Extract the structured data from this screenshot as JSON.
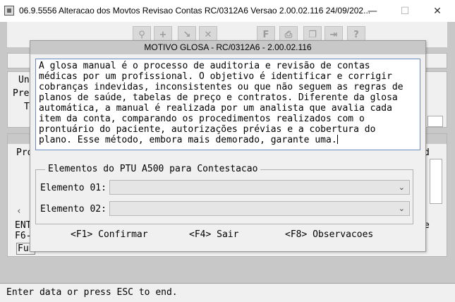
{
  "window": {
    "title": "06.9.5556  Alteracao  dos Movtos Revisao Contas RC/0312A6 Versao 2.00.02.116 24/09/202...",
    "minimize": "—",
    "maximize": "☐",
    "close": "✕"
  },
  "toolbar": {
    "buttons": [
      {
        "icon": "search-icon",
        "glyph": "⚲"
      },
      {
        "icon": "add-icon",
        "glyph": "+"
      },
      {
        "icon": "edit-icon",
        "glyph": "↘"
      },
      {
        "icon": "delete-icon",
        "glyph": "✕"
      },
      {
        "icon": "first-icon",
        "glyph": "F"
      },
      {
        "icon": "print-icon",
        "glyph": "⎙"
      },
      {
        "icon": "copy-icon",
        "glyph": "❐"
      },
      {
        "icon": "exit-icon",
        "glyph": "⇥"
      },
      {
        "icon": "help-icon",
        "glyph": "?"
      }
    ]
  },
  "background": {
    "label_un": "Un",
    "label_pre": "Pre",
    "label_t": "T",
    "grid_header_pro": "Pro",
    "grid_header_d": "d",
    "label_ent": "ENT",
    "label_f6": "F6-",
    "label_e": "e",
    "label_fun": "Fun"
  },
  "dialog": {
    "title": "MOTIVO GLOSA - RC/0312A6 - 2.00.02.116",
    "text_lines": [
      "A glosa manual é o processo de auditoria e revisão de contas",
      "médicas por um profissional. O objetivo é identificar e corrigir",
      "cobranças indevidas, inconsistentes ou que não seguem as regras de",
      "planos de saúde, tabelas de preço e contratos. Diferente da glosa",
      "automática, a manual é realizada por um analista que avalia cada",
      "item da conta, comparando os procedimentos realizados com o",
      "prontuário do paciente, autorizações prévias e a cobertura do",
      "plano. Esse método, embora mais demorado, garante uma."
    ],
    "fieldset_legend": "Elementos do PTU A500 para Contestacao",
    "element1_label": "Elemento 01:",
    "element1_value": "",
    "element2_label": "Elemento 02:",
    "element2_value": "",
    "fkey_confirm": "<F1> Confirmar",
    "fkey_exit": "<F4> Sair",
    "fkey_notes": "<F8> Observacoes"
  },
  "status": {
    "message": "Enter data or press ESC to end."
  }
}
